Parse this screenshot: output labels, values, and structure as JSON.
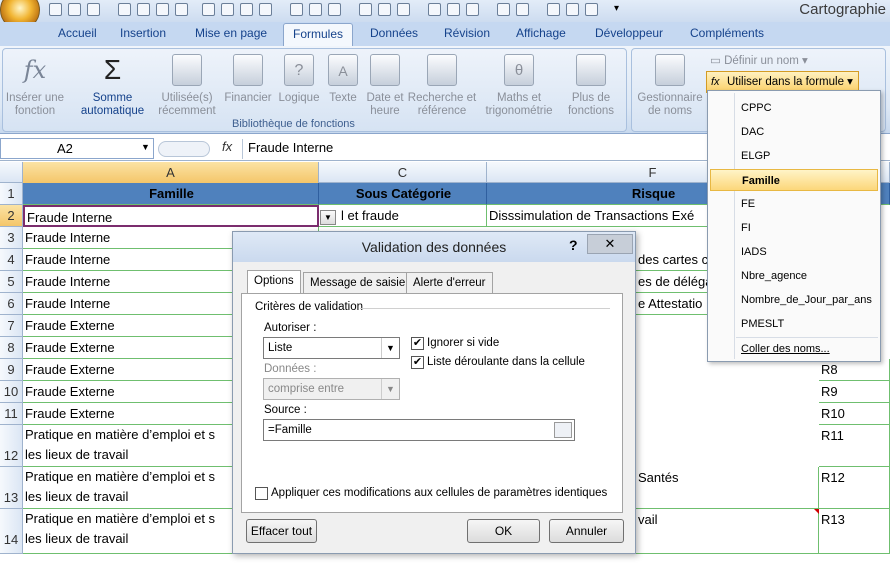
{
  "app": {
    "title": "Cartographie"
  },
  "tabs": [
    "Accueil",
    "Insertion",
    "Mise en page",
    "Formules",
    "Données",
    "Révision",
    "Affichage",
    "Développeur",
    "Compléments"
  ],
  "ribbon": {
    "insert_function": "Insérer une fonction",
    "autosum": "Somme automatique",
    "recent": "Utilisée(s) récemment",
    "financial": "Financier",
    "logical": "Logique",
    "text": "Texte",
    "datetime": "Date et heure",
    "lookup": "Recherche et référence",
    "math": "Maths et trigonométrie",
    "more": "Plus de fonctions",
    "group_label": "Bibliothèque de fonctions",
    "name_manager": "Gestionnaire de noms",
    "define_name": "Définir un nom",
    "use_in_formula": "Utiliser dans la formule"
  },
  "formula_bar": {
    "name_box": "A2",
    "fx": "fx",
    "value": "Fraude Interne"
  },
  "columns": [
    "A",
    "C",
    "F"
  ],
  "headers": {
    "famille": "Famille",
    "sous_categorie": "Sous Catégorie",
    "risque": "Risque"
  },
  "rows": [
    {
      "n": "1"
    },
    {
      "n": "2",
      "a": "Fraude Interne",
      "c": "l et fraude",
      "f": "Disssimulation de Transactions Exé"
    },
    {
      "n": "3",
      "a": "Fraude Interne"
    },
    {
      "n": "4",
      "a": "Fraude Interne",
      "f": "des cartes c"
    },
    {
      "n": "5",
      "a": "Fraude Interne",
      "f": "es de déléga"
    },
    {
      "n": "6",
      "a": "Fraude Interne",
      "f": "e Attestatio"
    },
    {
      "n": "7",
      "a": "Fraude Externe"
    },
    {
      "n": "8",
      "a": "Fraude Externe"
    },
    {
      "n": "9",
      "a": "Fraude Externe",
      "r": "R8"
    },
    {
      "n": "10",
      "a": "Fraude Externe",
      "r": "R9"
    },
    {
      "n": "11",
      "a": "Fraude Externe",
      "r": "R10"
    },
    {
      "n": "12",
      "a": "Pratique en matière d’emploi et s",
      "a2": "les lieux de travail",
      "r": "R11"
    },
    {
      "n": "13",
      "a": "Pratique en matière d’emploi et s",
      "a2": "les lieux de travail",
      "f": "Santés",
      "r": "R12"
    },
    {
      "n": "14",
      "a": "Pratique en matière d’emploi et s",
      "a2": "les lieux de travail",
      "f": "vail",
      "r": "R13"
    }
  ],
  "dialog": {
    "title": "Validation des données",
    "help": "?",
    "close": "✕",
    "tabs": [
      "Options",
      "Message de saisie",
      "Alerte d'erreur"
    ],
    "criteria": "Critères de validation",
    "allow_label": "Autoriser :",
    "allow_value": "Liste",
    "data_label": "Données :",
    "data_value": "comprise entre",
    "ignore_blank": "Ignorer si vide",
    "dropdown": "Liste déroulante dans la cellule",
    "source_label": "Source :",
    "source_value": "=Famille",
    "apply_all": "Appliquer ces modifications aux cellules de paramètres identiques",
    "clear_all": "Effacer tout",
    "ok": "OK",
    "cancel": "Annuler"
  },
  "menu": {
    "items": [
      "CPPC",
      "DAC",
      "ELGP",
      "Famille",
      "FE",
      "FI",
      "IADS",
      "Nbre_agence",
      "Nombre_de_Jour_par_ans",
      "PMESLT"
    ],
    "paste": "Coller des noms..."
  }
}
